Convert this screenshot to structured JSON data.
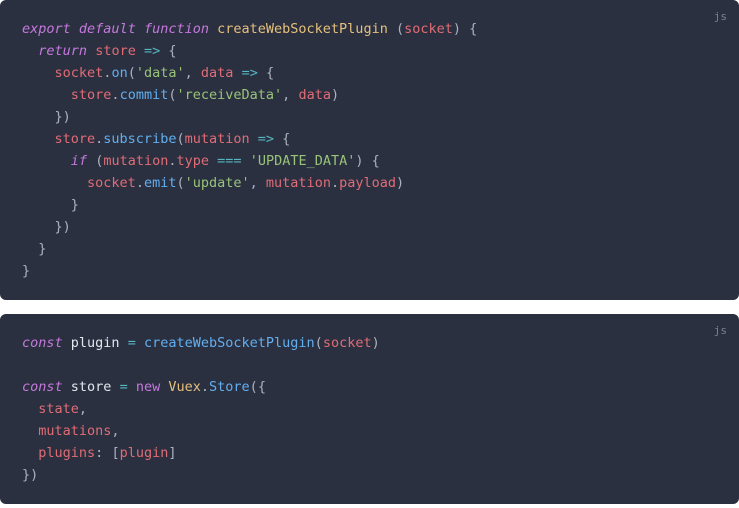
{
  "blocks": [
    {
      "lang": "js",
      "lines": [
        [
          {
            "t": "export",
            "c": "tok-kw"
          },
          {
            "t": " ",
            "c": "tok-plain"
          },
          {
            "t": "default",
            "c": "tok-kw"
          },
          {
            "t": " ",
            "c": "tok-plain"
          },
          {
            "t": "function",
            "c": "tok-kw"
          },
          {
            "t": " ",
            "c": "tok-plain"
          },
          {
            "t": "createWebSocketPlugin",
            "c": "tok-fndef"
          },
          {
            "t": " ",
            "c": "tok-plain"
          },
          {
            "t": "(",
            "c": "tok-pun"
          },
          {
            "t": "socket",
            "c": "tok-id"
          },
          {
            "t": ")",
            "c": "tok-pun"
          },
          {
            "t": " ",
            "c": "tok-plain"
          },
          {
            "t": "{",
            "c": "tok-pun"
          }
        ],
        [
          {
            "t": "  ",
            "c": "tok-plain"
          },
          {
            "t": "return",
            "c": "tok-ret"
          },
          {
            "t": " ",
            "c": "tok-plain"
          },
          {
            "t": "store",
            "c": "tok-id"
          },
          {
            "t": " ",
            "c": "tok-plain"
          },
          {
            "t": "=>",
            "c": "tok-op"
          },
          {
            "t": " ",
            "c": "tok-plain"
          },
          {
            "t": "{",
            "c": "tok-pun"
          }
        ],
        [
          {
            "t": "    ",
            "c": "tok-plain"
          },
          {
            "t": "socket",
            "c": "tok-id"
          },
          {
            "t": ".",
            "c": "tok-pun"
          },
          {
            "t": "on",
            "c": "tok-fn"
          },
          {
            "t": "(",
            "c": "tok-pun"
          },
          {
            "t": "'data'",
            "c": "tok-str"
          },
          {
            "t": ",",
            "c": "tok-pun"
          },
          {
            "t": " ",
            "c": "tok-plain"
          },
          {
            "t": "data",
            "c": "tok-id"
          },
          {
            "t": " ",
            "c": "tok-plain"
          },
          {
            "t": "=>",
            "c": "tok-op"
          },
          {
            "t": " ",
            "c": "tok-plain"
          },
          {
            "t": "{",
            "c": "tok-pun"
          }
        ],
        [
          {
            "t": "      ",
            "c": "tok-plain"
          },
          {
            "t": "store",
            "c": "tok-id"
          },
          {
            "t": ".",
            "c": "tok-pun"
          },
          {
            "t": "commit",
            "c": "tok-fn"
          },
          {
            "t": "(",
            "c": "tok-pun"
          },
          {
            "t": "'receiveData'",
            "c": "tok-str"
          },
          {
            "t": ",",
            "c": "tok-pun"
          },
          {
            "t": " ",
            "c": "tok-plain"
          },
          {
            "t": "data",
            "c": "tok-id"
          },
          {
            "t": ")",
            "c": "tok-pun"
          }
        ],
        [
          {
            "t": "    ",
            "c": "tok-plain"
          },
          {
            "t": "})",
            "c": "tok-pun"
          }
        ],
        [
          {
            "t": "    ",
            "c": "tok-plain"
          },
          {
            "t": "store",
            "c": "tok-id"
          },
          {
            "t": ".",
            "c": "tok-pun"
          },
          {
            "t": "subscribe",
            "c": "tok-fn"
          },
          {
            "t": "(",
            "c": "tok-pun"
          },
          {
            "t": "mutation",
            "c": "tok-id"
          },
          {
            "t": " ",
            "c": "tok-plain"
          },
          {
            "t": "=>",
            "c": "tok-op"
          },
          {
            "t": " ",
            "c": "tok-plain"
          },
          {
            "t": "{",
            "c": "tok-pun"
          }
        ],
        [
          {
            "t": "      ",
            "c": "tok-plain"
          },
          {
            "t": "if",
            "c": "tok-kw"
          },
          {
            "t": " ",
            "c": "tok-plain"
          },
          {
            "t": "(",
            "c": "tok-pun"
          },
          {
            "t": "mutation",
            "c": "tok-id"
          },
          {
            "t": ".",
            "c": "tok-pun"
          },
          {
            "t": "type",
            "c": "tok-id"
          },
          {
            "t": " ",
            "c": "tok-plain"
          },
          {
            "t": "===",
            "c": "tok-op"
          },
          {
            "t": " ",
            "c": "tok-plain"
          },
          {
            "t": "'UPDATE_DATA'",
            "c": "tok-str"
          },
          {
            "t": ")",
            "c": "tok-pun"
          },
          {
            "t": " ",
            "c": "tok-plain"
          },
          {
            "t": "{",
            "c": "tok-pun"
          }
        ],
        [
          {
            "t": "        ",
            "c": "tok-plain"
          },
          {
            "t": "socket",
            "c": "tok-id"
          },
          {
            "t": ".",
            "c": "tok-pun"
          },
          {
            "t": "emit",
            "c": "tok-fn"
          },
          {
            "t": "(",
            "c": "tok-pun"
          },
          {
            "t": "'update'",
            "c": "tok-str"
          },
          {
            "t": ",",
            "c": "tok-pun"
          },
          {
            "t": " ",
            "c": "tok-plain"
          },
          {
            "t": "mutation",
            "c": "tok-id"
          },
          {
            "t": ".",
            "c": "tok-pun"
          },
          {
            "t": "payload",
            "c": "tok-id"
          },
          {
            "t": ")",
            "c": "tok-pun"
          }
        ],
        [
          {
            "t": "      ",
            "c": "tok-plain"
          },
          {
            "t": "}",
            "c": "tok-pun"
          }
        ],
        [
          {
            "t": "    ",
            "c": "tok-plain"
          },
          {
            "t": "})",
            "c": "tok-pun"
          }
        ],
        [
          {
            "t": "  ",
            "c": "tok-plain"
          },
          {
            "t": "}",
            "c": "tok-pun"
          }
        ],
        [
          {
            "t": "}",
            "c": "tok-pun"
          }
        ]
      ]
    },
    {
      "lang": "js",
      "lines": [
        [
          {
            "t": "const",
            "c": "tok-kw"
          },
          {
            "t": " ",
            "c": "tok-plain"
          },
          {
            "t": "plugin",
            "c": "tok-def"
          },
          {
            "t": " ",
            "c": "tok-plain"
          },
          {
            "t": "=",
            "c": "tok-op"
          },
          {
            "t": " ",
            "c": "tok-plain"
          },
          {
            "t": "createWebSocketPlugin",
            "c": "tok-fn"
          },
          {
            "t": "(",
            "c": "tok-pun"
          },
          {
            "t": "socket",
            "c": "tok-id"
          },
          {
            "t": ")",
            "c": "tok-pun"
          }
        ],
        [],
        [
          {
            "t": "const",
            "c": "tok-kw"
          },
          {
            "t": " ",
            "c": "tok-plain"
          },
          {
            "t": "store",
            "c": "tok-def"
          },
          {
            "t": " ",
            "c": "tok-plain"
          },
          {
            "t": "=",
            "c": "tok-op"
          },
          {
            "t": " ",
            "c": "tok-plain"
          },
          {
            "t": "new",
            "c": "tok-new"
          },
          {
            "t": " ",
            "c": "tok-plain"
          },
          {
            "t": "Vuex",
            "c": "tok-cls"
          },
          {
            "t": ".",
            "c": "tok-pun"
          },
          {
            "t": "Store",
            "c": "tok-fn"
          },
          {
            "t": "(",
            "c": "tok-pun"
          },
          {
            "t": "{",
            "c": "tok-pun"
          }
        ],
        [
          {
            "t": "  ",
            "c": "tok-plain"
          },
          {
            "t": "state",
            "c": "tok-id"
          },
          {
            "t": ",",
            "c": "tok-pun"
          }
        ],
        [
          {
            "t": "  ",
            "c": "tok-plain"
          },
          {
            "t": "mutations",
            "c": "tok-id"
          },
          {
            "t": ",",
            "c": "tok-pun"
          }
        ],
        [
          {
            "t": "  ",
            "c": "tok-plain"
          },
          {
            "t": "plugins",
            "c": "tok-id"
          },
          {
            "t": ":",
            "c": "tok-pun"
          },
          {
            "t": " ",
            "c": "tok-plain"
          },
          {
            "t": "[",
            "c": "tok-pun"
          },
          {
            "t": "plugin",
            "c": "tok-id"
          },
          {
            "t": "]",
            "c": "tok-pun"
          }
        ],
        [
          {
            "t": "})",
            "c": "tok-pun"
          }
        ]
      ]
    }
  ]
}
